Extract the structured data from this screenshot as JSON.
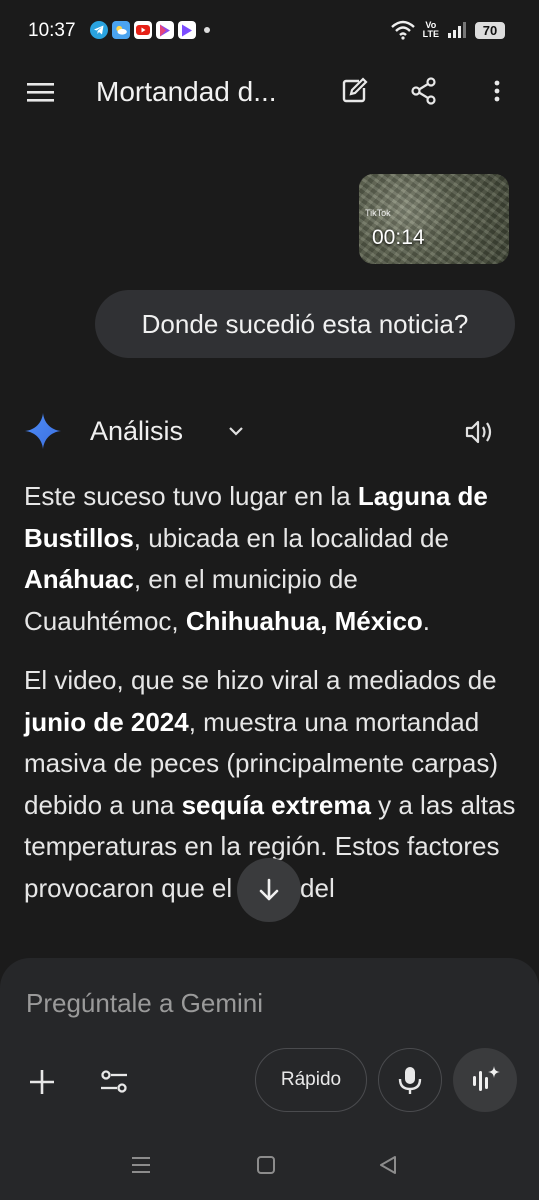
{
  "status_bar": {
    "time": "10:37",
    "notification_icons": [
      "telegram-icon",
      "weather-icon",
      "youtube-icon",
      "play-store-icon",
      "play-store-icon"
    ],
    "network": {
      "line1": "Vo",
      "line2": "LTE"
    },
    "battery": "70"
  },
  "app_bar": {
    "title": "Mortandad d...",
    "actions": [
      "edit-icon",
      "share-icon",
      "more-vert-icon"
    ]
  },
  "conversation": {
    "video": {
      "duration": "00:14",
      "watermark": "TikTok"
    },
    "user_message": "Donde sucedió esta noticia?",
    "model_label": "Análisis",
    "response": {
      "p1": [
        {
          "t": "Este suceso tuvo lugar en la ",
          "b": false
        },
        {
          "t": "Laguna de Bustillos",
          "b": true
        },
        {
          "t": ", ubicada en la localidad de ",
          "b": false
        },
        {
          "t": "Anáhuac",
          "b": true
        },
        {
          "t": ", en el municipio de Cuauhtémoc, ",
          "b": false
        },
        {
          "t": "Chihuahua, México",
          "b": true
        },
        {
          "t": ".",
          "b": false
        }
      ],
      "p2": [
        {
          "t": "El video, que se hizo viral a mediados de ",
          "b": false
        },
        {
          "t": "junio de 2024",
          "b": true
        },
        {
          "t": ", muestra una mortandad masiva de peces (principalmente carpas) debido a una ",
          "b": false
        },
        {
          "t": "sequía extrema",
          "b": true
        },
        {
          "t": " y a las altas temperaturas en la región. Estos factores provocaron que el nivel del",
          "b": false
        }
      ]
    }
  },
  "composer": {
    "placeholder": "Pregúntale a Gemini",
    "mode_label": "Rápido"
  },
  "colors": {
    "background": "#1b1b1b",
    "bubble": "#303134",
    "composer": "#262729",
    "gemini_blue": "#4285f4"
  }
}
